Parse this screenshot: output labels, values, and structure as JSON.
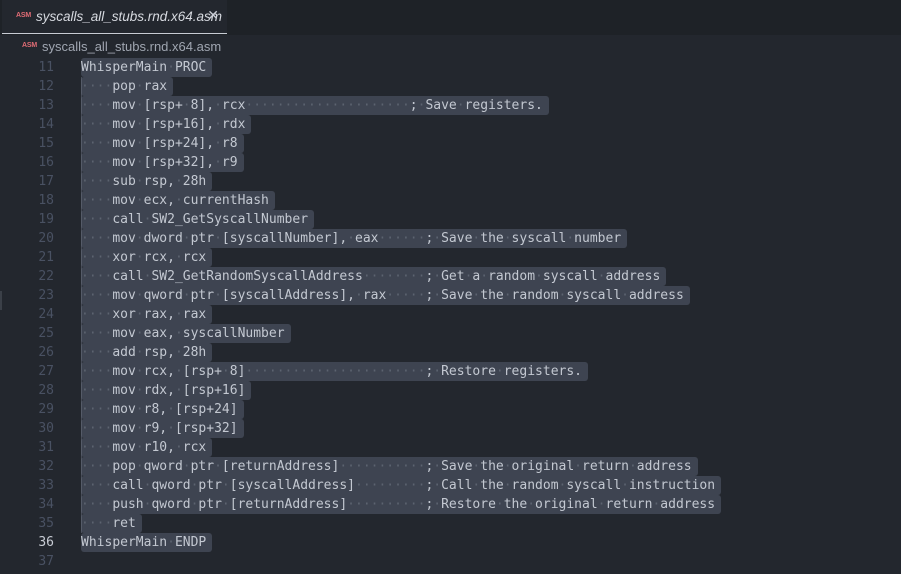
{
  "tab": {
    "icon": "asm-file-icon",
    "icon_text": "ASM",
    "label": "syscalls_all_stubs.rnd.x64.asm",
    "close": "✕"
  },
  "breadcrumb": {
    "icon_text": "ASM",
    "label": "syscalls_all_stubs.rnd.x64.asm"
  },
  "editor": {
    "active_line": 36,
    "lines": [
      {
        "n": "11",
        "text": "WhisperMain PROC"
      },
      {
        "n": "12",
        "text": "    pop rax"
      },
      {
        "n": "13",
        "text": "    mov [rsp+ 8], rcx                     ; Save registers."
      },
      {
        "n": "14",
        "text": "    mov [rsp+16], rdx"
      },
      {
        "n": "15",
        "text": "    mov [rsp+24], r8"
      },
      {
        "n": "16",
        "text": "    mov [rsp+32], r9"
      },
      {
        "n": "17",
        "text": "    sub rsp, 28h"
      },
      {
        "n": "18",
        "text": "    mov ecx, currentHash"
      },
      {
        "n": "19",
        "text": "    call SW2_GetSyscallNumber"
      },
      {
        "n": "20",
        "text": "    mov dword ptr [syscallNumber], eax      ; Save the syscall number"
      },
      {
        "n": "21",
        "text": "    xor rcx, rcx"
      },
      {
        "n": "22",
        "text": "    call SW2_GetRandomSyscallAddress        ; Get a random syscall address"
      },
      {
        "n": "23",
        "text": "    mov qword ptr [syscallAddress], rax     ; Save the random syscall address"
      },
      {
        "n": "24",
        "text": "    xor rax, rax"
      },
      {
        "n": "25",
        "text": "    mov eax, syscallNumber"
      },
      {
        "n": "26",
        "text": "    add rsp, 28h"
      },
      {
        "n": "27",
        "text": "    mov rcx, [rsp+ 8]                       ; Restore registers."
      },
      {
        "n": "28",
        "text": "    mov rdx, [rsp+16]"
      },
      {
        "n": "29",
        "text": "    mov r8, [rsp+24]"
      },
      {
        "n": "30",
        "text": "    mov r9, [rsp+32]"
      },
      {
        "n": "31",
        "text": "    mov r10, rcx"
      },
      {
        "n": "32",
        "text": "    pop qword ptr [returnAddress]           ; Save the original return address"
      },
      {
        "n": "33",
        "text": "    call qword ptr [syscallAddress]         ; Call the random syscall instruction"
      },
      {
        "n": "34",
        "text": "    push qword ptr [returnAddress]          ; Restore the original return address"
      },
      {
        "n": "35",
        "text": "    ret"
      },
      {
        "n": "36",
        "text": "WhisperMain ENDP"
      },
      {
        "n": "37",
        "text": ""
      }
    ]
  }
}
